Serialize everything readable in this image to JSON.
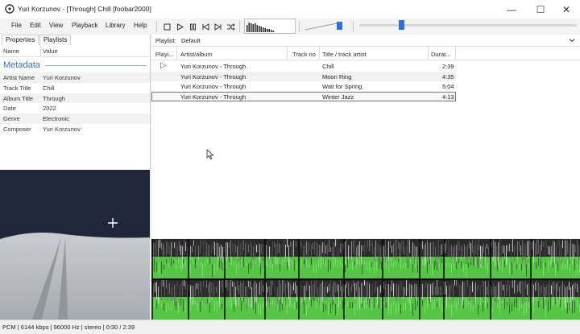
{
  "window": {
    "title": "Yuri Korzunov - [Through] Chill  [foobar2000]",
    "controls": [
      "—",
      "☐",
      "✕"
    ]
  },
  "menu": [
    "File",
    "Edit",
    "View",
    "Playback",
    "Library",
    "Help"
  ],
  "toolbar": {
    "buttons": [
      "stop-icon",
      "play-icon",
      "pause-icon",
      "previous-icon",
      "next-icon",
      "random-icon"
    ],
    "playback_position": 0.33
  },
  "left_panel": {
    "tabs": [
      "Properties",
      "Playlists"
    ],
    "columns": [
      "Name",
      "Value"
    ],
    "section_title": "Metadata",
    "properties": [
      {
        "name": "Artist Name",
        "value": "Yuri Korzunov"
      },
      {
        "name": "Track Title",
        "value": "Chill"
      },
      {
        "name": "Album Title",
        "value": "Through"
      },
      {
        "name": "Date",
        "value": "2022"
      },
      {
        "name": "Genre",
        "value": "Electronic"
      },
      {
        "name": "Composer",
        "value": "Yuri Korzunov"
      }
    ]
  },
  "playlist": {
    "label": "Playlist:",
    "selected": "Default",
    "columns": [
      "Playi...",
      "Artist/album",
      "Track no",
      "Title / track artist",
      "Durat..."
    ],
    "rows": [
      {
        "playing": "▷",
        "artist_album": "Yuri Korzunov - Through",
        "track_no": "",
        "title": "Chill",
        "duration": "2:39"
      },
      {
        "playing": "",
        "artist_album": "Yuri Korzunov - Through",
        "track_no": "",
        "title": "Moon Ring",
        "duration": "4:35"
      },
      {
        "playing": "",
        "artist_album": "Yuri Korzunov - Through",
        "track_no": "",
        "title": "Wait for Spring",
        "duration": "5:04"
      },
      {
        "playing": "",
        "artist_album": "Yuri Korzunov - Through",
        "track_no": "",
        "title": "Winter Jazz",
        "duration": "4:13"
      }
    ]
  },
  "status": {
    "text": "PCM | 6144 kbps | 96000 Hz | stereo | 0:30 / 2:39"
  },
  "colors": {
    "accent": "#2f6fd6",
    "metadata_title": "#3b6db7",
    "spectrogram_green": "#5ee04a"
  }
}
